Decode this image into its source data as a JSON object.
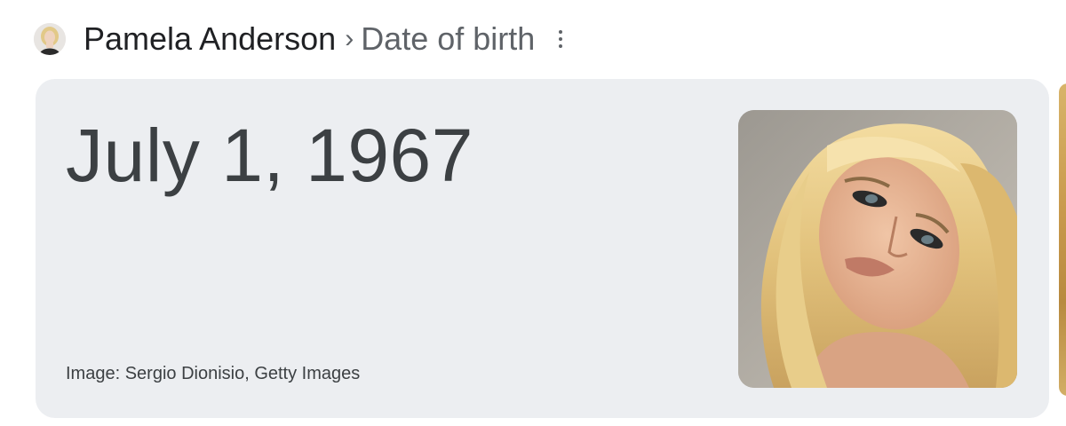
{
  "header": {
    "entity": "Pamela Anderson",
    "separator": "›",
    "attribute": "Date of birth",
    "avatar_icon": "person-avatar",
    "menu_icon": "more-vert-icon"
  },
  "card": {
    "answer": "July 1, 1967",
    "image_credit": "Image: Sergio Dionisio, Getty Images",
    "background": "#eceef1",
    "text_color": "#3c4043"
  }
}
